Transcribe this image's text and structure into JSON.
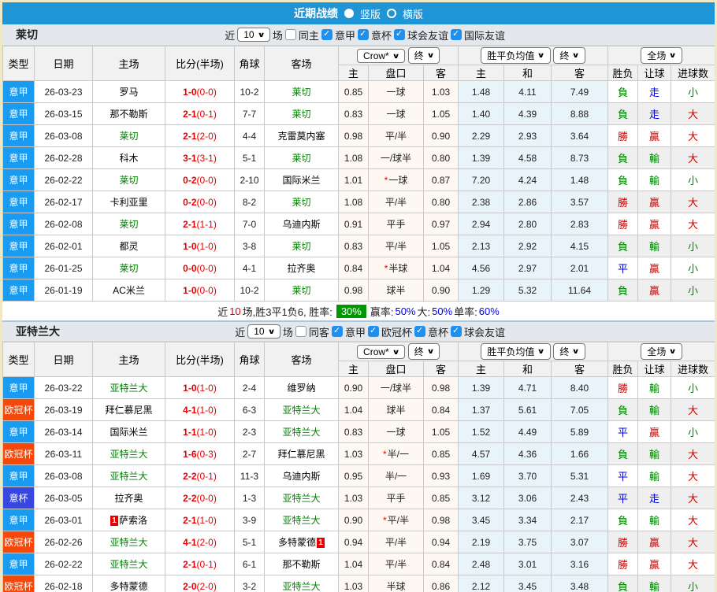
{
  "titlebar": {
    "title": "近期战绩",
    "vertical_label": "竖版",
    "horizontal_label": "横版"
  },
  "filter_common": {
    "near": "近",
    "count": "10",
    "games": "场"
  },
  "table_header": {
    "type": "类型",
    "date": "日期",
    "home": "主场",
    "score": "比分(半场)",
    "corner": "角球",
    "away": "客场",
    "company_select": "Crow*",
    "final_select_1": "终",
    "odds_select": "胜平负均值",
    "final_select_2": "终",
    "scope_select": "全场",
    "sub": [
      "主",
      "盘口",
      "客",
      "主",
      "和",
      "客",
      "胜负",
      "让球",
      "进球数"
    ]
  },
  "league_colors": {
    "意甲": "#1B9BEF",
    "欧冠杯": "#F5490B",
    "意杯": "#3847E0"
  },
  "result_colors": {
    "red": "#D40000",
    "green": "#008000",
    "blue": "#0000D8"
  },
  "sections": [
    {
      "team": "莱切",
      "same_side_label": "同主",
      "leagues": [
        "意甲",
        "意杯",
        "球会友谊",
        "国际友谊"
      ],
      "rows": [
        {
          "league": "意甲",
          "date": "26-03-23",
          "home": "罗马",
          "home_is_team": false,
          "home_card": "",
          "score": "1-0",
          "half": "(0-0)",
          "corner": "10-2",
          "away": "莱切",
          "away_is_team": true,
          "away_card": "",
          "ah": [
            "0.85",
            "一球",
            "1.03"
          ],
          "ah_star": false,
          "eu": [
            "1.48",
            "4.11",
            "7.49"
          ],
          "results": [
            [
              "負",
              "green"
            ],
            [
              "走",
              "blue"
            ],
            [
              "小",
              "green"
            ]
          ]
        },
        {
          "league": "意甲",
          "date": "26-03-15",
          "home": "那不勒斯",
          "home_is_team": false,
          "home_card": "",
          "score": "2-1",
          "half": "(0-1)",
          "corner": "7-7",
          "away": "莱切",
          "away_is_team": true,
          "away_card": "",
          "ah": [
            "0.83",
            "一球",
            "1.05"
          ],
          "ah_star": false,
          "eu": [
            "1.40",
            "4.39",
            "8.88"
          ],
          "results": [
            [
              "負",
              "green"
            ],
            [
              "走",
              "blue"
            ],
            [
              "大",
              "red"
            ]
          ]
        },
        {
          "league": "意甲",
          "date": "26-03-08",
          "home": "莱切",
          "home_is_team": true,
          "home_card": "",
          "score": "2-1",
          "half": "(2-0)",
          "corner": "4-4",
          "away": "克雷莫内塞",
          "away_is_team": false,
          "away_card": "",
          "ah": [
            "0.98",
            "平/半",
            "0.90"
          ],
          "ah_star": false,
          "eu": [
            "2.29",
            "2.93",
            "3.64"
          ],
          "results": [
            [
              "勝",
              "red"
            ],
            [
              "贏",
              "red"
            ],
            [
              "大",
              "red"
            ]
          ]
        },
        {
          "league": "意甲",
          "date": "26-02-28",
          "home": "科木",
          "home_is_team": false,
          "home_card": "",
          "score": "3-1",
          "half": "(3-1)",
          "corner": "5-1",
          "away": "莱切",
          "away_is_team": true,
          "away_card": "",
          "ah": [
            "1.08",
            "一/球半",
            "0.80"
          ],
          "ah_star": false,
          "eu": [
            "1.39",
            "4.58",
            "8.73"
          ],
          "results": [
            [
              "負",
              "green"
            ],
            [
              "輸",
              "green"
            ],
            [
              "大",
              "red"
            ]
          ]
        },
        {
          "league": "意甲",
          "date": "26-02-22",
          "home": "莱切",
          "home_is_team": true,
          "home_card": "",
          "score": "0-2",
          "half": "(0-0)",
          "corner": "2-10",
          "away": "国际米兰",
          "away_is_team": false,
          "away_card": "",
          "ah": [
            "1.01",
            "一球",
            "0.87"
          ],
          "ah_star": true,
          "eu": [
            "7.20",
            "4.24",
            "1.48"
          ],
          "results": [
            [
              "負",
              "green"
            ],
            [
              "輸",
              "green"
            ],
            [
              "小",
              "green"
            ]
          ]
        },
        {
          "league": "意甲",
          "date": "26-02-17",
          "home": "卡利亚里",
          "home_is_team": false,
          "home_card": "",
          "score": "0-2",
          "half": "(0-0)",
          "corner": "8-2",
          "away": "莱切",
          "away_is_team": true,
          "away_card": "",
          "ah": [
            "1.08",
            "平/半",
            "0.80"
          ],
          "ah_star": false,
          "eu": [
            "2.38",
            "2.86",
            "3.57"
          ],
          "results": [
            [
              "勝",
              "red"
            ],
            [
              "贏",
              "red"
            ],
            [
              "大",
              "red"
            ]
          ]
        },
        {
          "league": "意甲",
          "date": "26-02-08",
          "home": "莱切",
          "home_is_team": true,
          "home_card": "",
          "score": "2-1",
          "half": "(1-1)",
          "corner": "7-0",
          "away": "乌迪内斯",
          "away_is_team": false,
          "away_card": "",
          "ah": [
            "0.91",
            "平手",
            "0.97"
          ],
          "ah_star": false,
          "eu": [
            "2.94",
            "2.80",
            "2.83"
          ],
          "results": [
            [
              "勝",
              "red"
            ],
            [
              "贏",
              "red"
            ],
            [
              "大",
              "red"
            ]
          ]
        },
        {
          "league": "意甲",
          "date": "26-02-01",
          "home": "都灵",
          "home_is_team": false,
          "home_card": "",
          "score": "1-0",
          "half": "(1-0)",
          "corner": "3-8",
          "away": "莱切",
          "away_is_team": true,
          "away_card": "",
          "ah": [
            "0.83",
            "平/半",
            "1.05"
          ],
          "ah_star": false,
          "eu": [
            "2.13",
            "2.92",
            "4.15"
          ],
          "results": [
            [
              "負",
              "green"
            ],
            [
              "輸",
              "green"
            ],
            [
              "小",
              "green"
            ]
          ]
        },
        {
          "league": "意甲",
          "date": "26-01-25",
          "home": "莱切",
          "home_is_team": true,
          "home_card": "",
          "score": "0-0",
          "half": "(0-0)",
          "corner": "4-1",
          "away": "拉齐奥",
          "away_is_team": false,
          "away_card": "",
          "ah": [
            "0.84",
            "半球",
            "1.04"
          ],
          "ah_star": true,
          "eu": [
            "4.56",
            "2.97",
            "2.01"
          ],
          "results": [
            [
              "平",
              "blue"
            ],
            [
              "贏",
              "red"
            ],
            [
              "小",
              "green"
            ]
          ]
        },
        {
          "league": "意甲",
          "date": "26-01-19",
          "home": "AC米兰",
          "home_is_team": false,
          "home_card": "",
          "score": "1-0",
          "half": "(0-0)",
          "corner": "10-2",
          "away": "莱切",
          "away_is_team": true,
          "away_card": "",
          "ah": [
            "0.98",
            "球半",
            "0.90"
          ],
          "ah_star": false,
          "eu": [
            "1.29",
            "5.32",
            "11.64"
          ],
          "results": [
            [
              "負",
              "green"
            ],
            [
              "贏",
              "red"
            ],
            [
              "小",
              "green"
            ]
          ]
        }
      ],
      "summary": [
        {
          "t": "近",
          "c": "#222"
        },
        {
          "t": "10",
          "c": "#E80000"
        },
        {
          "t": "场,胜3平1负6, 胜率:",
          "c": "#222"
        },
        {
          "t": "30%",
          "badge": true
        },
        {
          "t": "赢率:",
          "c": "#222"
        },
        {
          "t": "50%",
          "c": "#0000EE"
        },
        {
          "t": " 大:",
          "c": "#222"
        },
        {
          "t": "50%",
          "c": "#0000EE"
        },
        {
          "t": " 单率:",
          "c": "#222"
        },
        {
          "t": "60%",
          "c": "#0000EE"
        }
      ]
    },
    {
      "team": "亚特兰大",
      "same_side_label": "同客",
      "leagues": [
        "意甲",
        "欧冠杯",
        "意杯",
        "球会友谊"
      ],
      "rows": [
        {
          "league": "意甲",
          "date": "26-03-22",
          "home": "亚特兰大",
          "home_is_team": true,
          "home_card": "",
          "score": "1-0",
          "half": "(1-0)",
          "corner": "2-4",
          "away": "维罗纳",
          "away_is_team": false,
          "away_card": "",
          "ah": [
            "0.90",
            "一/球半",
            "0.98"
          ],
          "ah_star": false,
          "eu": [
            "1.39",
            "4.71",
            "8.40"
          ],
          "results": [
            [
              "勝",
              "red"
            ],
            [
              "輸",
              "green"
            ],
            [
              "小",
              "green"
            ]
          ]
        },
        {
          "league": "欧冠杯",
          "date": "26-03-19",
          "home": "拜仁慕尼黑",
          "home_is_team": false,
          "home_card": "",
          "score": "4-1",
          "half": "(1-0)",
          "corner": "6-3",
          "away": "亚特兰大",
          "away_is_team": true,
          "away_card": "",
          "ah": [
            "1.04",
            "球半",
            "0.84"
          ],
          "ah_star": false,
          "eu": [
            "1.37",
            "5.61",
            "7.05"
          ],
          "results": [
            [
              "負",
              "green"
            ],
            [
              "輸",
              "green"
            ],
            [
              "大",
              "red"
            ]
          ]
        },
        {
          "league": "意甲",
          "date": "26-03-14",
          "home": "国际米兰",
          "home_is_team": false,
          "home_card": "",
          "score": "1-1",
          "half": "(1-0)",
          "corner": "2-3",
          "away": "亚特兰大",
          "away_is_team": true,
          "away_card": "",
          "ah": [
            "0.83",
            "一球",
            "1.05"
          ],
          "ah_star": false,
          "eu": [
            "1.52",
            "4.49",
            "5.89"
          ],
          "results": [
            [
              "平",
              "blue"
            ],
            [
              "贏",
              "red"
            ],
            [
              "小",
              "green"
            ]
          ]
        },
        {
          "league": "欧冠杯",
          "date": "26-03-11",
          "home": "亚特兰大",
          "home_is_team": true,
          "home_card": "",
          "score": "1-6",
          "half": "(0-3)",
          "corner": "2-7",
          "away": "拜仁慕尼黑",
          "away_is_team": false,
          "away_card": "",
          "ah": [
            "1.03",
            "半/一",
            "0.85"
          ],
          "ah_star": true,
          "eu": [
            "4.57",
            "4.36",
            "1.66"
          ],
          "results": [
            [
              "負",
              "green"
            ],
            [
              "輸",
              "green"
            ],
            [
              "大",
              "red"
            ]
          ]
        },
        {
          "league": "意甲",
          "date": "26-03-08",
          "home": "亚特兰大",
          "home_is_team": true,
          "home_card": "",
          "score": "2-2",
          "half": "(0-1)",
          "corner": "11-3",
          "away": "乌迪内斯",
          "away_is_team": false,
          "away_card": "",
          "ah": [
            "0.95",
            "半/一",
            "0.93"
          ],
          "ah_star": false,
          "eu": [
            "1.69",
            "3.70",
            "5.31"
          ],
          "results": [
            [
              "平",
              "blue"
            ],
            [
              "輸",
              "green"
            ],
            [
              "大",
              "red"
            ]
          ]
        },
        {
          "league": "意杯",
          "date": "26-03-05",
          "home": "拉齐奥",
          "home_is_team": false,
          "home_card": "",
          "score": "2-2",
          "half": "(0-0)",
          "corner": "1-3",
          "away": "亚特兰大",
          "away_is_team": true,
          "away_card": "",
          "ah": [
            "1.03",
            "平手",
            "0.85"
          ],
          "ah_star": false,
          "eu": [
            "3.12",
            "3.06",
            "2.43"
          ],
          "results": [
            [
              "平",
              "blue"
            ],
            [
              "走",
              "blue"
            ],
            [
              "大",
              "red"
            ]
          ]
        },
        {
          "league": "意甲",
          "date": "26-03-01",
          "home": "萨索洛",
          "home_is_team": false,
          "home_card": "1",
          "score": "2-1",
          "half": "(1-0)",
          "corner": "3-9",
          "away": "亚特兰大",
          "away_is_team": true,
          "away_card": "",
          "ah": [
            "0.90",
            "平/半",
            "0.98"
          ],
          "ah_star": true,
          "eu": [
            "3.45",
            "3.34",
            "2.17"
          ],
          "results": [
            [
              "負",
              "green"
            ],
            [
              "輸",
              "green"
            ],
            [
              "大",
              "red"
            ]
          ]
        },
        {
          "league": "欧冠杯",
          "date": "26-02-26",
          "home": "亚特兰大",
          "home_is_team": true,
          "home_card": "",
          "score": "4-1",
          "half": "(2-0)",
          "corner": "5-1",
          "away": "多特蒙德",
          "away_is_team": false,
          "away_card": "1",
          "ah": [
            "0.94",
            "平/半",
            "0.94"
          ],
          "ah_star": false,
          "eu": [
            "2.19",
            "3.75",
            "3.07"
          ],
          "results": [
            [
              "勝",
              "red"
            ],
            [
              "贏",
              "red"
            ],
            [
              "大",
              "red"
            ]
          ]
        },
        {
          "league": "意甲",
          "date": "26-02-22",
          "home": "亚特兰大",
          "home_is_team": true,
          "home_card": "",
          "score": "2-1",
          "half": "(0-1)",
          "corner": "6-1",
          "away": "那不勒斯",
          "away_is_team": false,
          "away_card": "",
          "ah": [
            "1.04",
            "平/半",
            "0.84"
          ],
          "ah_star": false,
          "eu": [
            "2.48",
            "3.01",
            "3.16"
          ],
          "results": [
            [
              "勝",
              "red"
            ],
            [
              "贏",
              "red"
            ],
            [
              "大",
              "red"
            ]
          ]
        },
        {
          "league": "欧冠杯",
          "date": "26-02-18",
          "home": "多特蒙德",
          "home_is_team": false,
          "home_card": "",
          "score": "2-0",
          "half": "(2-0)",
          "corner": "3-2",
          "away": "亚特兰大",
          "away_is_team": true,
          "away_card": "",
          "ah": [
            "1.03",
            "半球",
            "0.86"
          ],
          "ah_star": false,
          "eu": [
            "2.12",
            "3.45",
            "3.48"
          ],
          "results": [
            [
              "負",
              "green"
            ],
            [
              "輸",
              "green"
            ],
            [
              "小",
              "green"
            ]
          ]
        }
      ],
      "summary": null
    }
  ]
}
